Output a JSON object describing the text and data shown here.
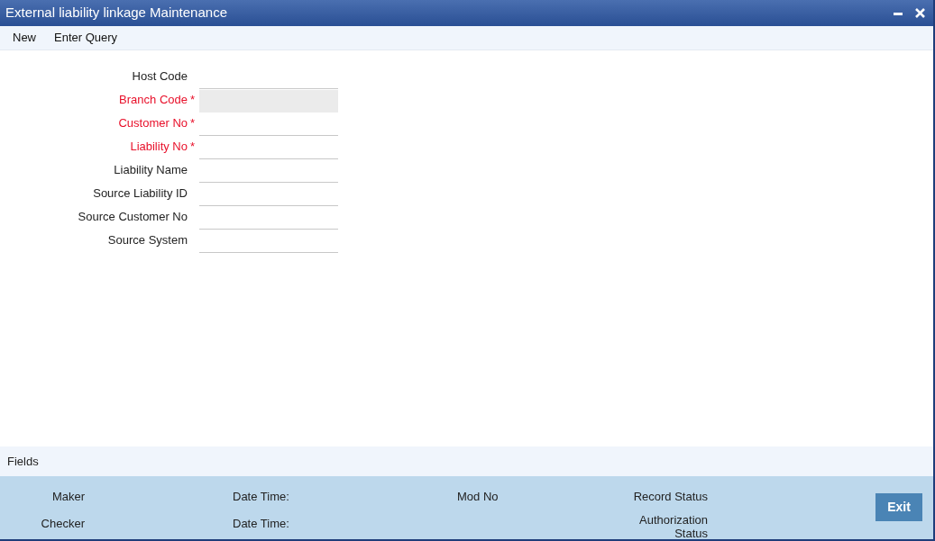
{
  "window": {
    "title": "External liability linkage Maintenance"
  },
  "toolbar": [
    "New",
    "Enter Query"
  ],
  "form": {
    "fields": [
      {
        "label": "Host Code",
        "required": false,
        "disabled": false
      },
      {
        "label": "Branch Code",
        "required": true,
        "disabled": true
      },
      {
        "label": "Customer No",
        "required": true,
        "disabled": false
      },
      {
        "label": "Liability No",
        "required": true,
        "disabled": false
      },
      {
        "label": "Liability Name",
        "required": false,
        "disabled": false
      },
      {
        "label": "Source Liability ID",
        "required": false,
        "disabled": false
      },
      {
        "label": "Source Customer No",
        "required": false,
        "disabled": false
      },
      {
        "label": "Source System",
        "required": false,
        "disabled": false
      }
    ],
    "required_mark": "*"
  },
  "fields_bar": {
    "label": "Fields"
  },
  "audit": {
    "maker": "Maker",
    "maker_date_time": "Date Time:",
    "mod_no": "Mod No",
    "record_status": "Record Status",
    "checker": "Checker",
    "checker_date_time": "Date Time:",
    "authorization_status": "Authorization Status"
  },
  "exit_button": "Exit"
}
